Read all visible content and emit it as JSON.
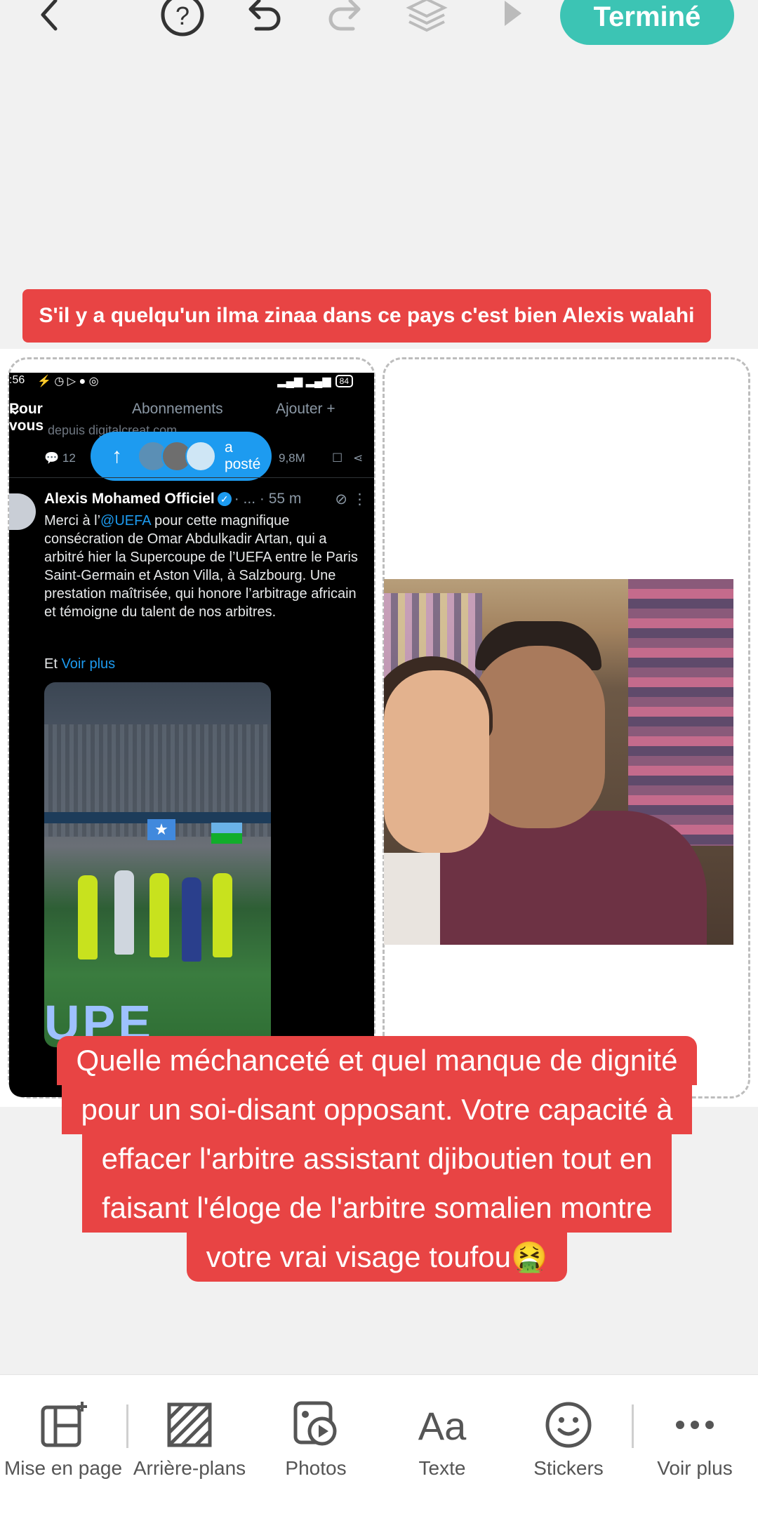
{
  "toolbar": {
    "back_icon": "chevron-left-icon",
    "help_icon": "help-circle-icon",
    "undo_icon": "undo-icon",
    "redo_icon": "redo-icon",
    "layers_icon": "layers-icon",
    "play_icon": "play-icon",
    "done_label": "Terminé",
    "accent_color": "#3cc4b4"
  },
  "captions": {
    "top": "S'il y a quelqu'un ilma zinaa dans ce pays c'est bien Alexis walahi",
    "main_lines": [
      "Quelle méchanceté et quel manque de dignité",
      "pour un soi-disant opposant. Votre capacité à",
      "effacer l'arbitre assistant djiboutien tout en",
      "faisant l'éloge de l'arbitre somalien montre",
      "votre vrai visage  toufou🤮"
    ],
    "color": "#e84444"
  },
  "screenshot": {
    "status_time": ":56",
    "battery": "84",
    "tabs": {
      "active": "Pour vous",
      "subscriptions": "Abonnements",
      "add": "Ajouter +"
    },
    "faded_text": "depuis digitalcreat.com",
    "replies": "12",
    "views": "9,8M",
    "posted_label": "a posté",
    "author": "Alexis Mohamed Officiel",
    "meta": "· ... · 55 m",
    "body_before": "Merci à l’",
    "mention": "@UEFA",
    "body_after": " pour cette magnifique consécration de Omar Abdulkadir Artan, qui a arbitré hier la Supercoupe de l’UEFA entre le Paris Saint-Germain et Aston Villa, à Salzbourg. Une prestation maîtrisée, qui honore l’arbitrage africain et témoigne du talent de nos arbitres.",
    "more_prefix": "Et ",
    "more_link": "Voir plus",
    "media_banner": "UPE",
    "link_color": "#1d9bf0"
  },
  "bottom_bar": {
    "items": [
      {
        "label": "Mise en page",
        "icon": "layout-add-icon"
      },
      {
        "label": "Arrière-plans",
        "icon": "background-pattern-icon"
      },
      {
        "label": "Photos",
        "icon": "photos-icon"
      },
      {
        "label": "Texte",
        "icon": "text-aa-icon"
      },
      {
        "label": "Stickers",
        "icon": "smiley-icon"
      },
      {
        "label": "Voir plus",
        "icon": "more-dots-icon"
      }
    ]
  }
}
